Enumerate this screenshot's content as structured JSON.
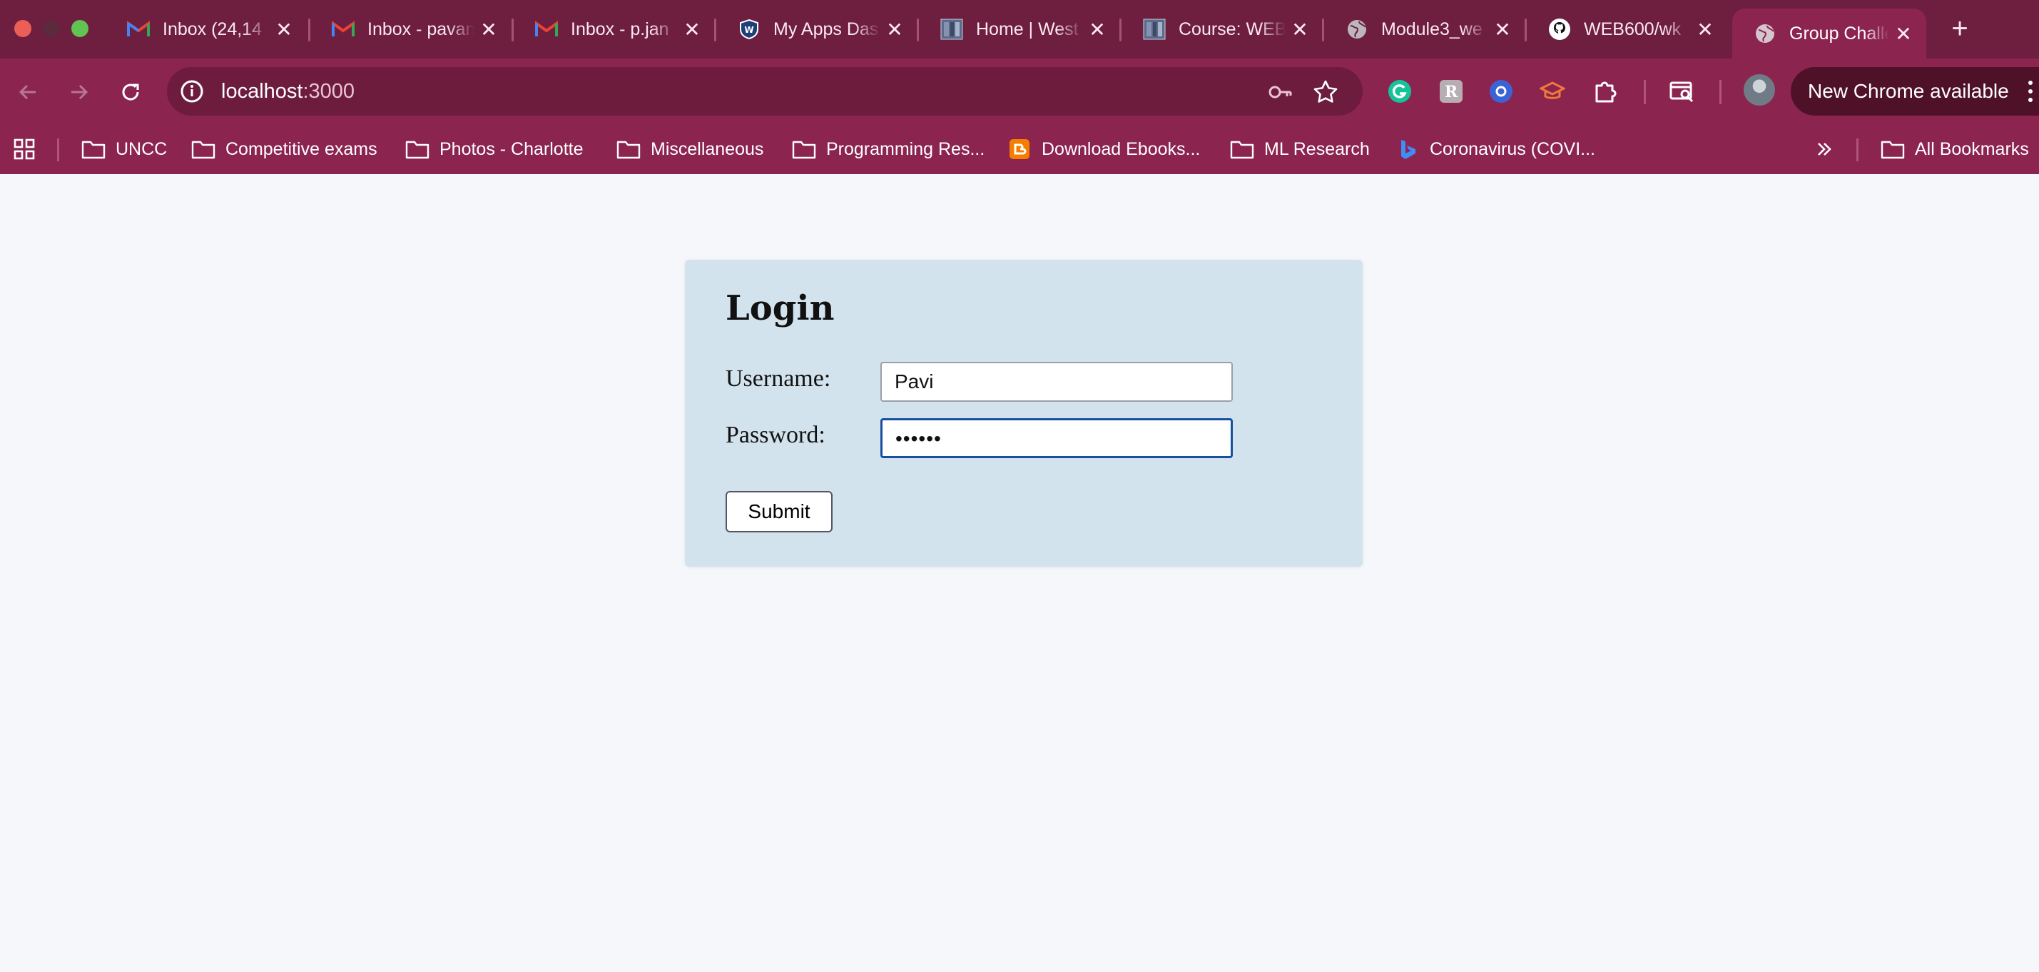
{
  "browser": {
    "tabs": [
      {
        "title": "Inbox (24,14",
        "icon": "gmail-icon"
      },
      {
        "title": "Inbox - pavan",
        "icon": "gmail-icon"
      },
      {
        "title": "Inbox - p.jan",
        "icon": "gmail-icon"
      },
      {
        "title": "My Apps Das",
        "icon": "shield-icon"
      },
      {
        "title": "Home | West",
        "icon": "site-icon"
      },
      {
        "title": "Course: WEB",
        "icon": "site-icon"
      },
      {
        "title": "Module3_we",
        "icon": "globe-icon"
      },
      {
        "title": "WEB600/wk",
        "icon": "github-icon"
      },
      {
        "title": "Group Challe",
        "icon": "globe-icon"
      }
    ],
    "active_tab_index": 8,
    "address_bar": {
      "host": "localhost",
      "port": ":3000"
    },
    "update_chip": "New Chrome available",
    "bookmarks": [
      {
        "label": "UNCC",
        "icon": "folder-icon"
      },
      {
        "label": "Competitive exams",
        "icon": "folder-icon"
      },
      {
        "label": "Photos - Charlotte",
        "icon": "folder-icon"
      },
      {
        "label": "Miscellaneous",
        "icon": "folder-icon"
      },
      {
        "label": "Programming Res...",
        "icon": "folder-icon"
      },
      {
        "label": "Download Ebooks...",
        "icon": "blogger-icon"
      },
      {
        "label": "ML Research",
        "icon": "folder-icon"
      },
      {
        "label": "Coronavirus (COVI...",
        "icon": "bing-icon"
      }
    ],
    "all_bookmarks": "All Bookmarks"
  },
  "login": {
    "title": "Login",
    "username_label": "Username:",
    "username_value": "Pavi",
    "password_label": "Password:",
    "password_value": "••••••",
    "submit_label": "Submit"
  },
  "colors": {
    "tabstrip": "#6e1f3f",
    "toolbar": "#8c2450",
    "card": "#d3e3ed",
    "focus_ring": "#1a4fa0"
  }
}
